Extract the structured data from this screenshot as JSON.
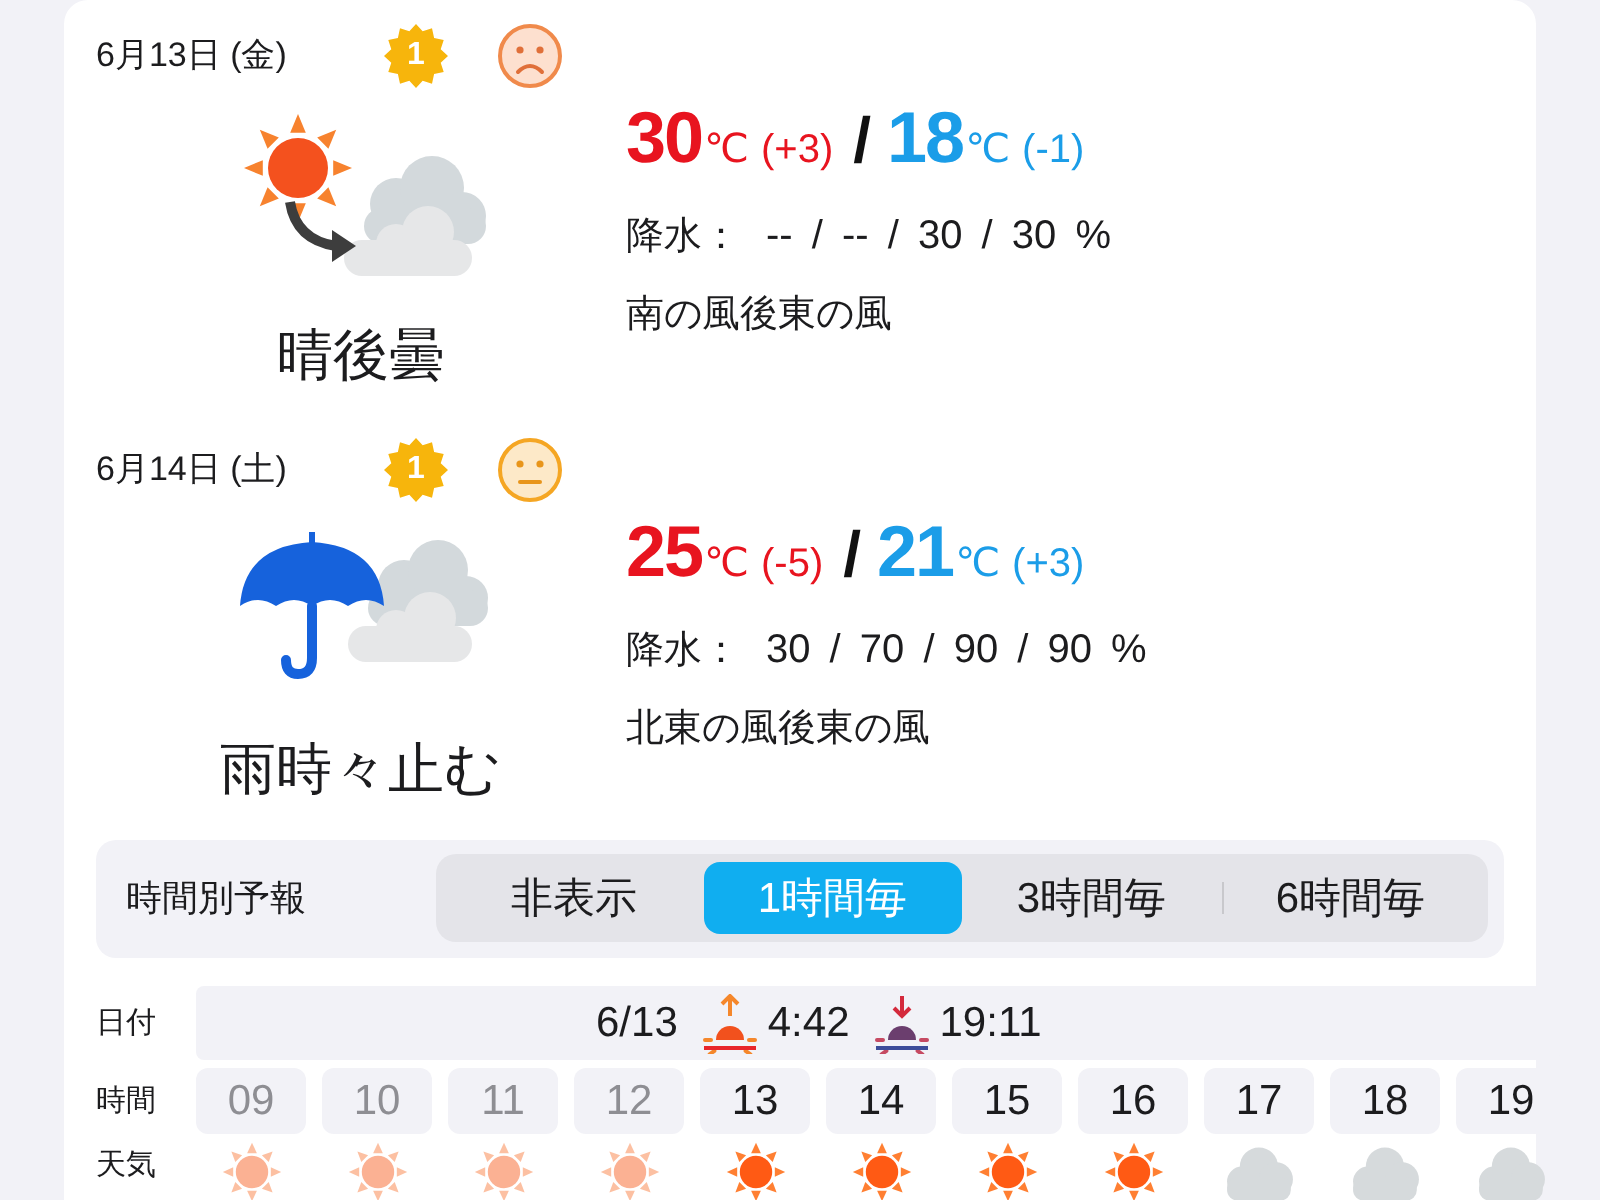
{
  "days": [
    {
      "kind": "sun_then_cloud",
      "date": "6月13日 (金)",
      "badge": "1",
      "face": {
        "kind": "sad"
      },
      "weather": "晴後曇",
      "high": "30",
      "high_unit": "℃",
      "high_change": "(+3)",
      "separator": "/",
      "low": "18",
      "low_unit": "℃",
      "low_change": "(-1)",
      "precip_label": "降水：",
      "precip": "-- / -- / 30 / 30 %",
      "wind": "南の風後東の風"
    },
    {
      "kind": "rain_with_cloud",
      "date": "6月14日 (土)",
      "badge": "1",
      "face": {
        "kind": "neutral"
      },
      "weather": "雨時々止む",
      "high": "25",
      "high_unit": "℃",
      "high_change": "(-5)",
      "separator": "/",
      "low": "21",
      "low_unit": "℃",
      "low_change": "(+3)",
      "precip_label": "降水：",
      "precip": "30 / 70 / 90 / 90 %",
      "wind": "北東の風後東の風"
    }
  ],
  "hourly": {
    "label": "時間別予報",
    "options": [
      {
        "label": "非表示",
        "selected": false
      },
      {
        "label": "1時間毎",
        "selected": true
      },
      {
        "label": "3時間毎",
        "selected": false
      },
      {
        "label": "6時間毎",
        "selected": false
      }
    ],
    "date_label": "日付",
    "date": "6/13",
    "sunrise": "4:42",
    "sunset": "19:11",
    "time_label": "時間",
    "weather_label": "天気",
    "hours": [
      {
        "kind": "sun",
        "hour": "09",
        "past": true
      },
      {
        "kind": "sun",
        "hour": "10",
        "past": true
      },
      {
        "kind": "sun",
        "hour": "11",
        "past": true
      },
      {
        "kind": "sun",
        "hour": "12",
        "past": true
      },
      {
        "kind": "sun",
        "hour": "13",
        "past": false
      },
      {
        "kind": "sun",
        "hour": "14",
        "past": false
      },
      {
        "kind": "sun",
        "hour": "15",
        "past": false
      },
      {
        "kind": "sun",
        "hour": "16",
        "past": false
      },
      {
        "kind": "cloud",
        "hour": "17",
        "past": false
      },
      {
        "kind": "cloud",
        "hour": "18",
        "past": false
      },
      {
        "kind": "cloud",
        "hour": "19",
        "past": false
      }
    ]
  }
}
